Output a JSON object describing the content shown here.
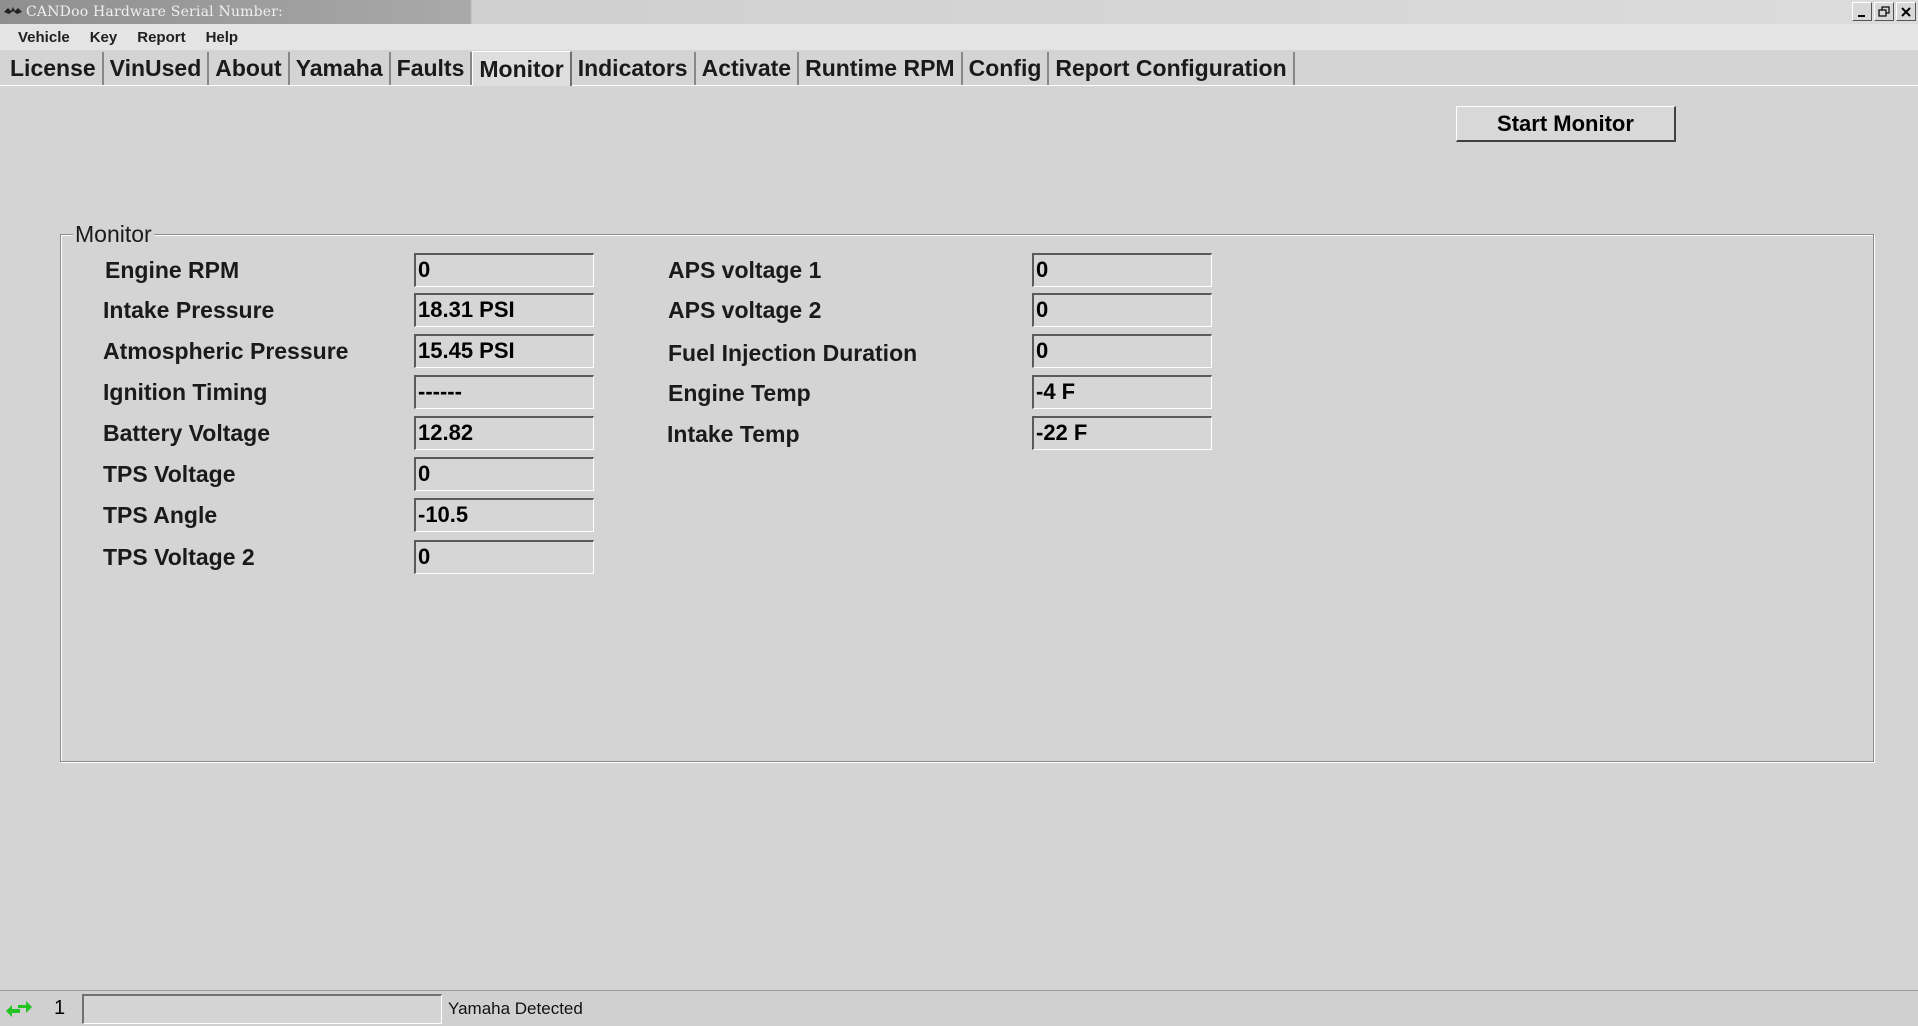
{
  "window": {
    "title": "CANDoo  Hardware Serial Number:",
    "controls": [
      "minimize-icon",
      "restore-icon",
      "close-icon"
    ]
  },
  "menu": [
    "Vehicle",
    "Key",
    "Report",
    "Help"
  ],
  "tabs": [
    {
      "label": "License",
      "active": false
    },
    {
      "label": "VinUsed",
      "active": false
    },
    {
      "label": "About",
      "active": false
    },
    {
      "label": "Yamaha",
      "active": false
    },
    {
      "label": "Faults",
      "active": false
    },
    {
      "label": "Monitor",
      "active": true
    },
    {
      "label": "Indicators",
      "active": false
    },
    {
      "label": "Activate",
      "active": false
    },
    {
      "label": "Runtime RPM",
      "active": false
    },
    {
      "label": "Config",
      "active": false
    },
    {
      "label": "Report Configuration",
      "active": false
    }
  ],
  "start_button": "Start Monitor",
  "monitor": {
    "title": "Monitor",
    "left": [
      {
        "label": "Engine RPM",
        "value": "0"
      },
      {
        "label": "Intake Pressure",
        "value": "18.31 PSI"
      },
      {
        "label": "Atmospheric Pressure",
        "value": "15.45 PSI"
      },
      {
        "label": "Ignition Timing",
        "value": "------"
      },
      {
        "label": "Battery Voltage",
        "value": "12.82"
      },
      {
        "label": "TPS Voltage",
        "value": "0"
      },
      {
        "label": "TPS Angle",
        "value": "-10.5"
      },
      {
        "label": "TPS Voltage 2",
        "value": "0"
      }
    ],
    "right": [
      {
        "label": "APS voltage 1",
        "value": "0"
      },
      {
        "label": "APS voltage 2",
        "value": "0"
      },
      {
        "label": "Fuel Injection Duration",
        "value": "0"
      },
      {
        "label": "Engine Temp",
        "value": "-4 F"
      },
      {
        "label": "Intake Temp",
        "value": "-22 F"
      }
    ]
  },
  "status": {
    "icon": "connection-arrows-icon",
    "count": "1",
    "message": "Yamaha Detected"
  }
}
